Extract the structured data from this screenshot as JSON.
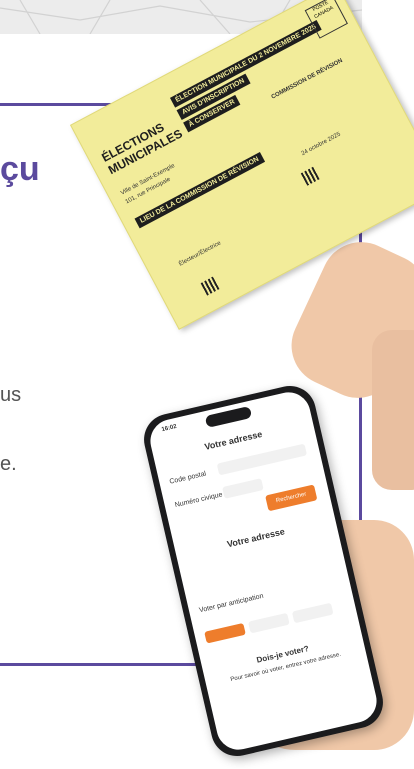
{
  "colors": {
    "accent": "#5b4a9e",
    "card": "#f2ec9a",
    "orange": "#ee7d2c"
  },
  "page": {
    "heading_fragment": "çu",
    "side_line1": "us",
    "side_line2": "e."
  },
  "card": {
    "logo_line1": "ÉLECTIONS",
    "logo_line2": "MUNICIPALES",
    "band_title": "ÉLECTION MUNICIPALE DU 2 NOVEMBRE 2025",
    "band_left": "AVIS D'INSCRIPTION",
    "band_mid": "À CONSERVER",
    "commission": "COMMISSION DE RÉVISION",
    "lieu": "LIEU DE LA COMMISSION DE RÉVISION",
    "addr1": "Ville de Saint-Exemple",
    "addr2": "101, rue Principale",
    "dates": "24 octobre 2025",
    "resident": "Électeur/Électrice",
    "stamp_top": "POSTE",
    "stamp_bottom": "CANADA"
  },
  "phone": {
    "time": "16:02",
    "title1": "Votre adresse",
    "label_postal": "Code postal",
    "label_number": "Numéro civique",
    "button": "Rechercher",
    "title2": "Votre adresse",
    "vote_label": "Voter par anticipation",
    "where_title": "Dois-je voter?",
    "where_text": "Pour savoir où voter, entrez votre adresse."
  }
}
